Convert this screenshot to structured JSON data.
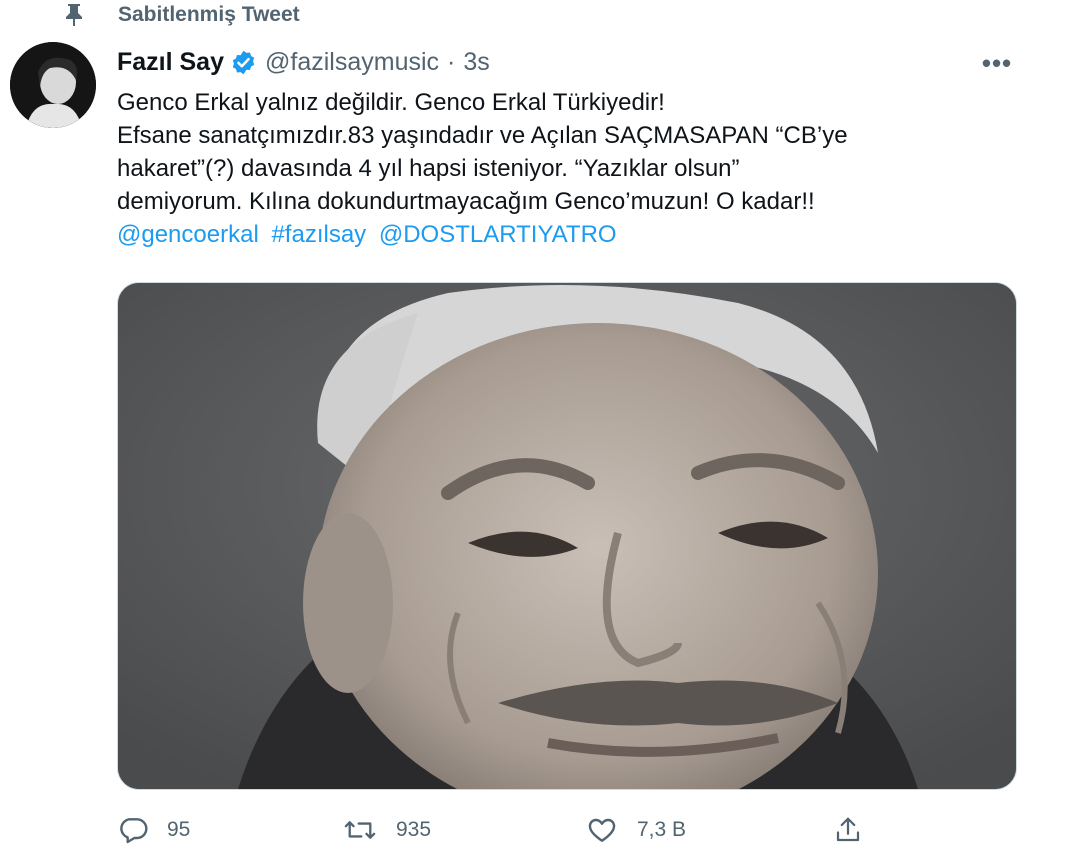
{
  "pinned": {
    "label": "Sabitlenmiş Tweet",
    "icon": "pin-icon"
  },
  "tweet": {
    "author_name": "Fazıl Say",
    "handle": "@fazilsaymusic",
    "separator": "·",
    "time": "3s",
    "more_label": "•••",
    "text_lines": [
      "Genco Erkal yalnız değildir. Genco Erkal Türkiyedir!",
      "Efsane sanatçımızdır.83 yaşındadır ve Açılan SAÇMASAPAN “CB’ye",
      "hakaret”(?) davasında 4 yıl hapsi isteniyor. “Yazıklar olsun”",
      "demiyorum. Kılına dokundurtmayacağım Genco’muzun! O kadar!!"
    ],
    "links": [
      "@gencoerkal",
      "#fazılsay",
      "@DOSTLARTIYATRO"
    ],
    "link_color": "#1d9bf0",
    "verified_color": "#1d9bf0"
  },
  "actions": {
    "reply_count": "95",
    "retweet_count": "935",
    "like_count": "7,3 B"
  }
}
